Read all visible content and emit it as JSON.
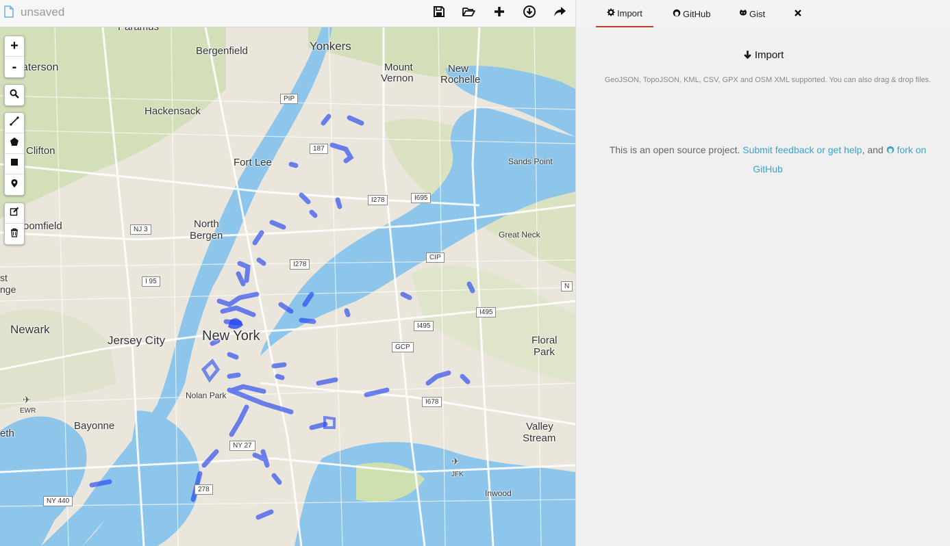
{
  "file": {
    "name": "unsaved",
    "icon": "file-icon"
  },
  "toolbar": {
    "buttons": [
      {
        "name": "save-button",
        "icon": "floppy-icon"
      },
      {
        "name": "open-button",
        "icon": "folder-open-icon"
      },
      {
        "name": "new-button",
        "icon": "plus-icon"
      },
      {
        "name": "download-button",
        "icon": "download-circle-icon"
      },
      {
        "name": "share-button",
        "icon": "share-icon"
      }
    ]
  },
  "tabs": [
    {
      "label": "Import",
      "icon": "gear-icon",
      "active": true
    },
    {
      "label": "GitHub",
      "icon": "github-icon",
      "active": false
    },
    {
      "label": "Gist",
      "icon": "octocat-icon",
      "active": false
    },
    {
      "label": "",
      "icon": "close-icon",
      "active": false
    }
  ],
  "import_panel": {
    "title": "Import",
    "description": "GeoJSON, TopoJSON, KML, CSV, GPX and OSM XML supported. You can also drag & drop files."
  },
  "about": {
    "text_before": "This is an open source project. ",
    "feedback_link": "Submit feedback or get help",
    "text_middle": ", and ",
    "fork_link": "fork on GitHub"
  },
  "map_controls": {
    "zoom_in": "+",
    "zoom_out": "-"
  },
  "map": {
    "labels": {
      "paramus": "Paramus",
      "yonkers": "Yonkers",
      "bergenfield": "Bergenfield",
      "mount": "Mount",
      "vernon": "Vernon",
      "new": "New",
      "rochelle": "Rochelle",
      "paterson": "aterson",
      "hackensack": "Hackensack",
      "clifton": "Clifton",
      "fort_lee": "Fort Lee",
      "sands_point": "Sands Point",
      "north": "North",
      "bergen": "Bergen",
      "great_neck": "Great Neck",
      "bloomfield": "oomfield",
      "east_orange_1": "st",
      "east_orange_2": "nge",
      "new_york": "New York",
      "newark": "Newark",
      "jersey_city": "Jersey City",
      "floral": "Floral",
      "park": "Park",
      "nolan_park": "Nolan Park",
      "ewr": "EWR",
      "bayonne": "Bayonne",
      "valley": "Valley",
      "stream": "Stream",
      "elizabeth": "eth",
      "jfk": "JFK",
      "inwood": "Inwood"
    },
    "shields": {
      "pip": "PIP",
      "i87": "187",
      "i278a": "I278",
      "i695": "I695",
      "nj3": "NJ 3",
      "i278b": "I278",
      "cip": "CIP",
      "i95": "I 95",
      "i495a": "I495",
      "i495b": "I495",
      "gcp": "GCP",
      "i678": "I678",
      "ny27": "NY 27",
      "i278c": "278",
      "ny440": "NY 440",
      "n": "N"
    }
  }
}
